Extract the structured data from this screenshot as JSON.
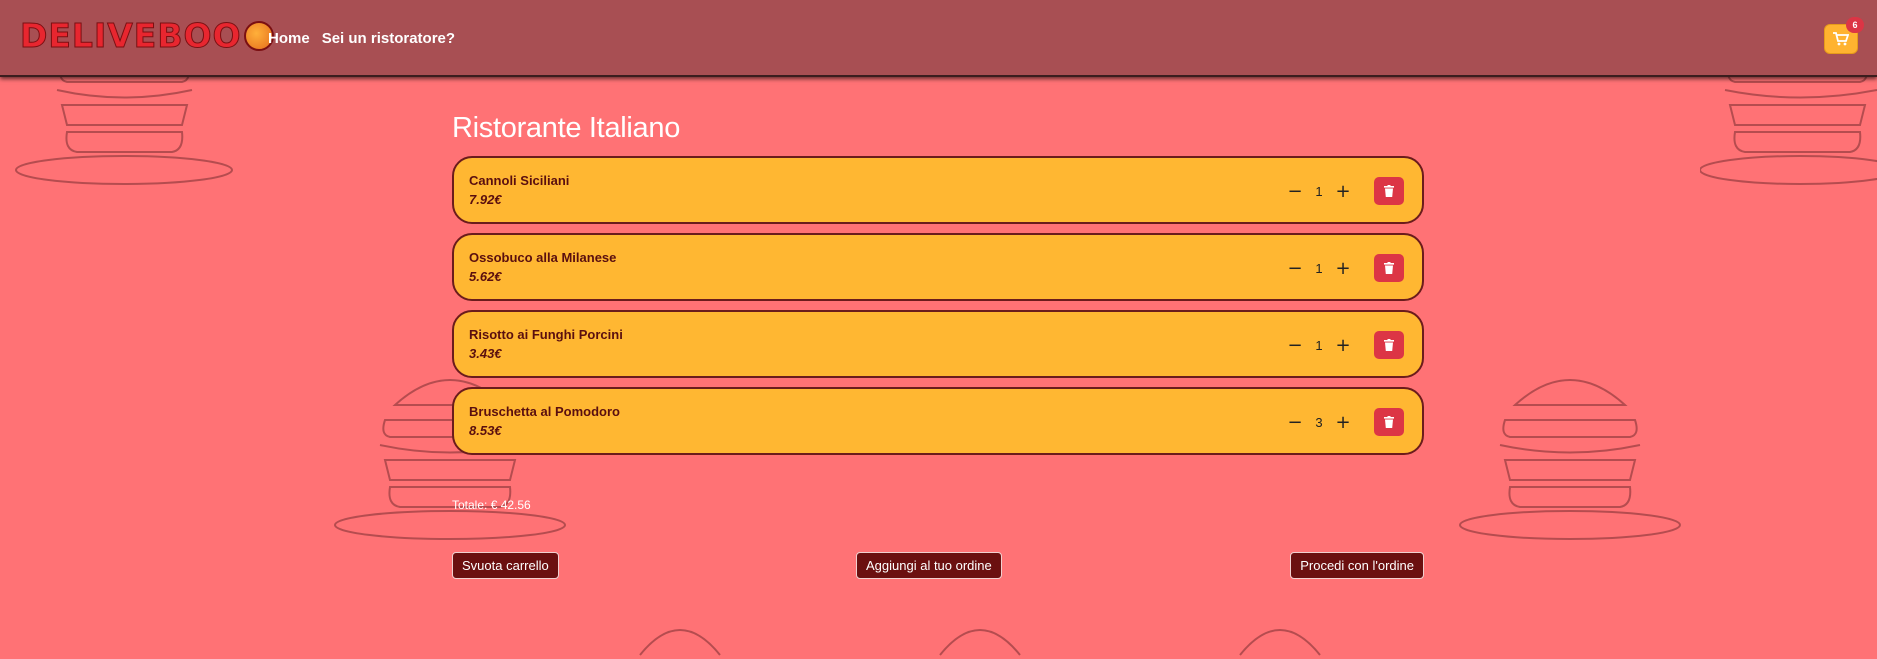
{
  "navbar": {
    "logo_text": "DELIVEBOO",
    "links": [
      "Home",
      "Sei un ristoratore?"
    ],
    "cart_count": "6",
    "cart_icon": "shopping-cart-icon"
  },
  "cart": {
    "title": "Ristorante Italiano",
    "items": [
      {
        "name": "Cannoli Siciliani",
        "price": "7.92€",
        "qty": "1"
      },
      {
        "name": "Ossobuco alla Milanese",
        "price": "5.62€",
        "qty": "1"
      },
      {
        "name": "Risotto ai Funghi Porcini",
        "price": "3.43€",
        "qty": "1"
      },
      {
        "name": "Bruschetta al Pomodoro",
        "price": "8.53€",
        "qty": "3"
      }
    ],
    "minus_symbol": "−",
    "plus_symbol": "+",
    "delete_icon": "trash-icon",
    "total_label": "Totale: € 42.56"
  },
  "actions": {
    "empty_cart": "Svuota carrello",
    "add_to_order": "Aggiungi al tuo ordine",
    "proceed": "Procedi con l'ordine"
  },
  "colors": {
    "background": "#ff7275",
    "navbar": "#a84f53",
    "item_card": "#ffb732",
    "delete_button": "#dc3545",
    "action_button": "#6b1010",
    "cart_button": "#ffb330"
  }
}
